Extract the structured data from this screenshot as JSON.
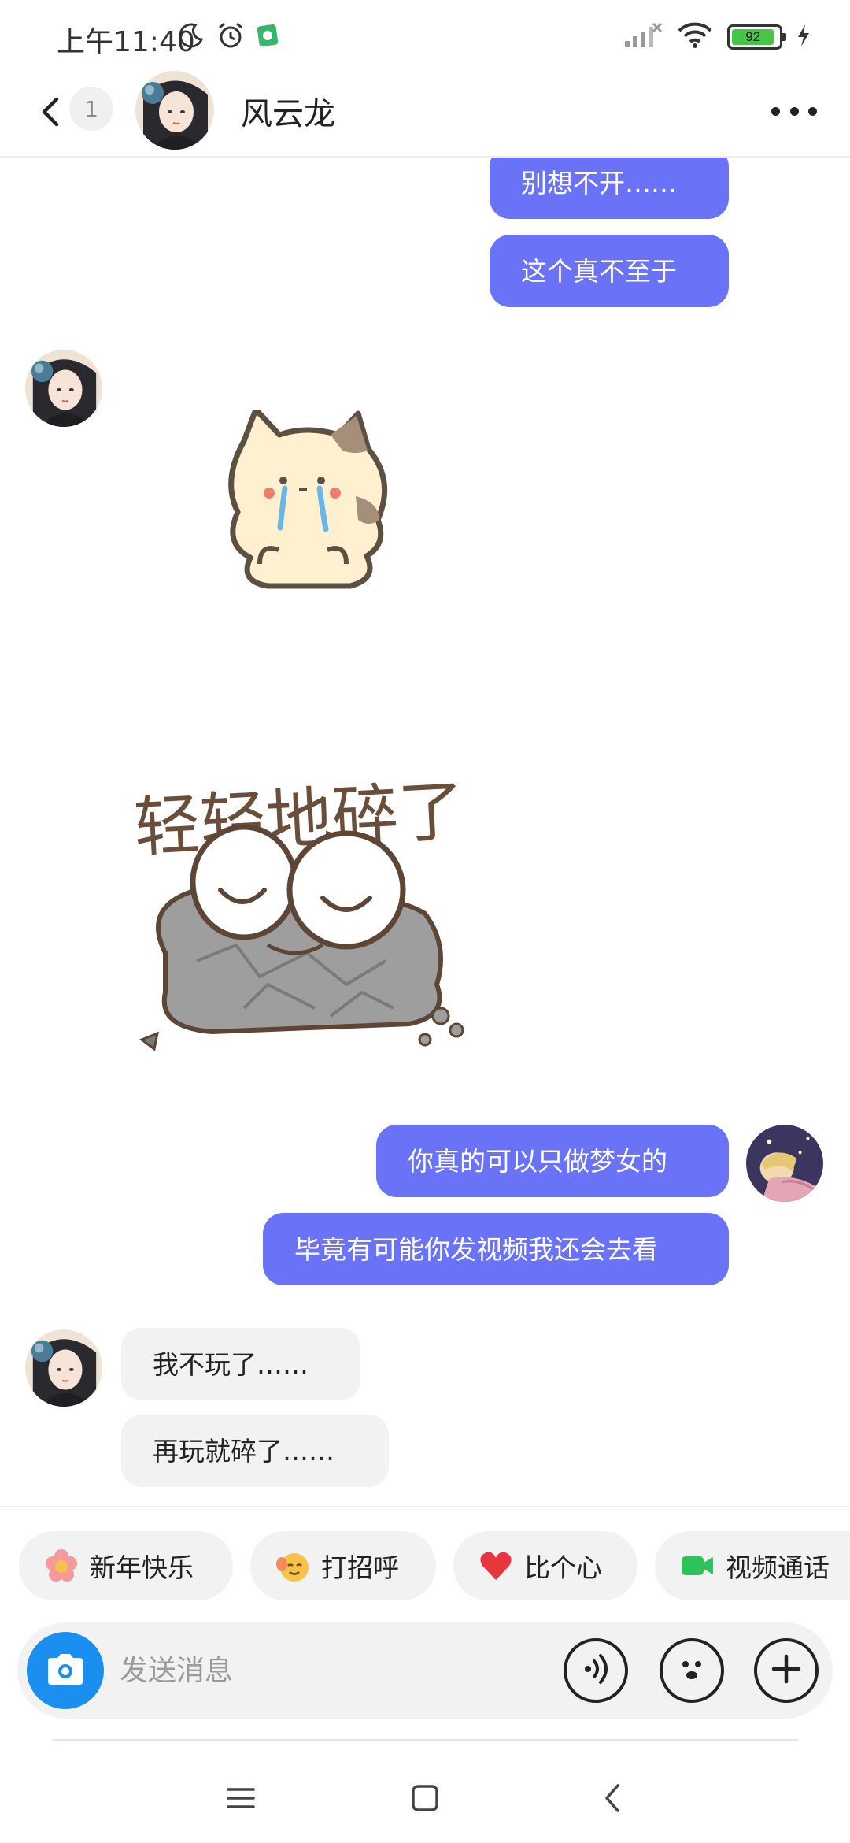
{
  "status_bar": {
    "time": "上午11:40",
    "battery_level": "92",
    "left_icons": [
      "moon-icon",
      "alarm-icon",
      "app-notification-icon"
    ],
    "right_icons": [
      "signal-icon",
      "wifi-icon",
      "battery-icon",
      "charging-icon"
    ]
  },
  "header": {
    "unread_count": "1",
    "contact_name": "风云龙"
  },
  "messages": [
    {
      "direction": "out",
      "text": "别想不开……"
    },
    {
      "direction": "out",
      "text": "这个真不至于"
    },
    {
      "direction": "in",
      "sticker": "crying-cat-sticker"
    },
    {
      "direction": "in",
      "sticker": "broken-frog-sticker",
      "sticker_text": "轻轻地碎了"
    },
    {
      "direction": "out",
      "text": "你真的可以只做梦女的"
    },
    {
      "direction": "out",
      "text": "毕竟有可能你发视频我还会去看"
    },
    {
      "direction": "in",
      "text": "我不玩了……"
    },
    {
      "direction": "in",
      "text": "再玩就碎了……"
    }
  ],
  "quick_replies": [
    {
      "label": "新年快乐",
      "icon": "flower-icon"
    },
    {
      "label": "打招呼",
      "icon": "wave-emoji-icon"
    },
    {
      "label": "比个心",
      "icon": "heart-icon"
    },
    {
      "label": "视频通话",
      "icon": "video-call-icon"
    }
  ],
  "input": {
    "placeholder": "发送消息"
  },
  "colors": {
    "outgoing_bubble": "#6a73f7",
    "incoming_bubble": "#f2f2f2",
    "camera_button": "#1b8ff0",
    "battery_fill": "#47c449"
  }
}
